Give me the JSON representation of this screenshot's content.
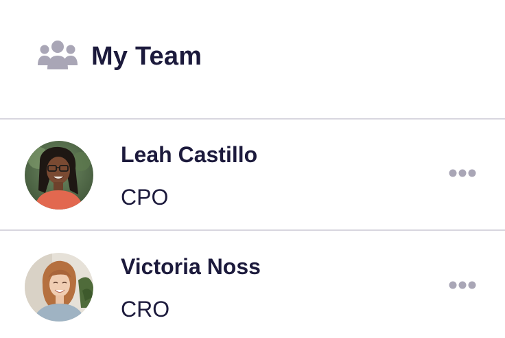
{
  "header": {
    "icon": "users-group-icon",
    "title": "My Team"
  },
  "members": [
    {
      "name": "Leah Castillo",
      "role": "CPO",
      "avatar": "avatar-photo",
      "menu_icon": "more-horizontal-icon"
    },
    {
      "name": "Victoria Noss",
      "role": "CRO",
      "avatar": "avatar-photo",
      "menu_icon": "more-horizontal-icon"
    }
  ],
  "colors": {
    "text": "#1c1a3c",
    "icon": "#a9a6b6",
    "divider": "#d8d6df",
    "background": "#ffffff"
  }
}
